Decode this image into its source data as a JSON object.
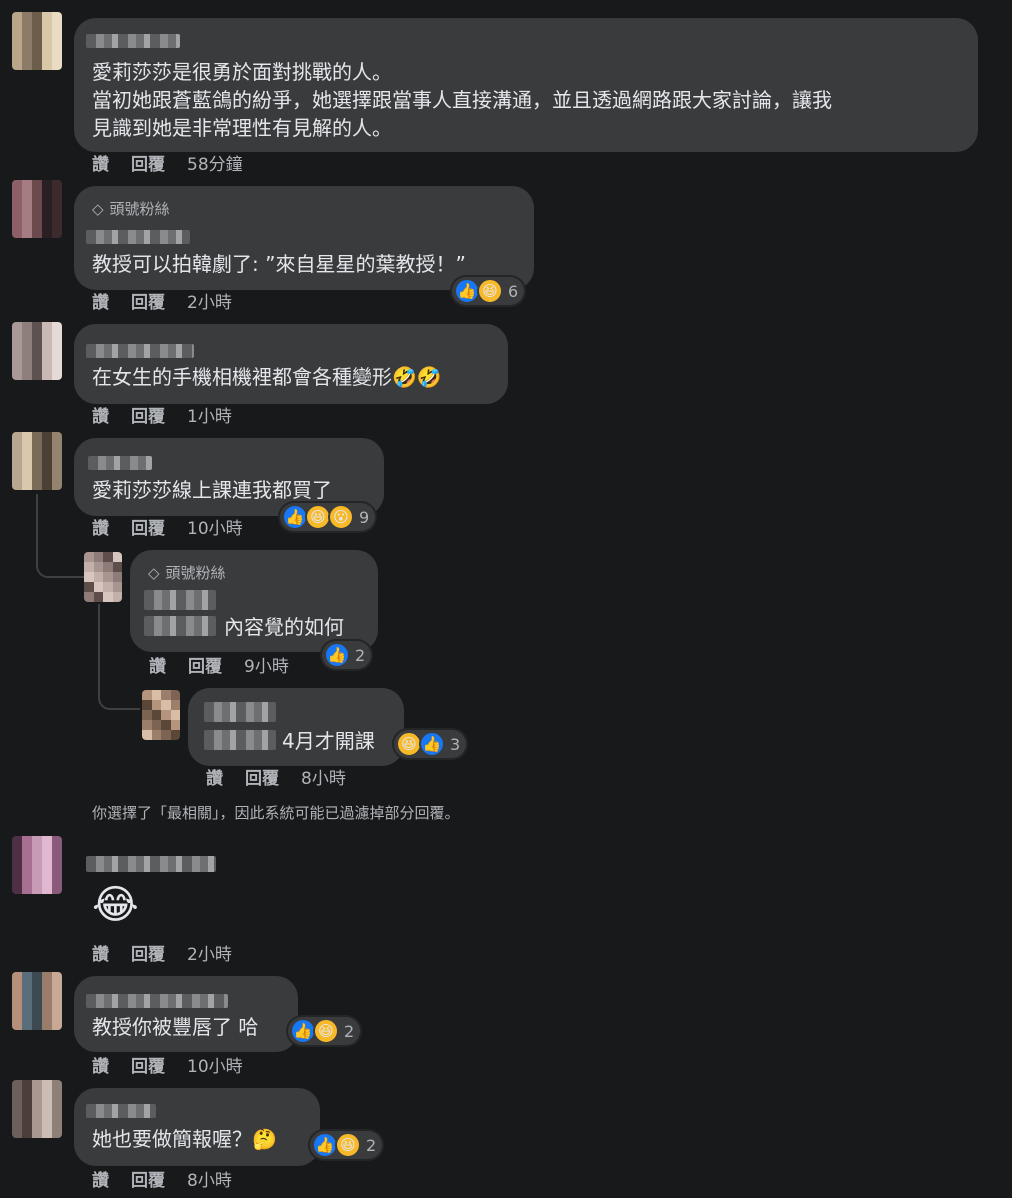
{
  "actions": {
    "like": "讚",
    "reply": "回覆"
  },
  "fan_badge": "頭號粉絲",
  "comments": [
    {
      "lines": [
        "愛莉莎莎是很勇於面對挑戰的人。",
        "當初她跟蒼藍鴿的紛爭，她選擇跟當事人直接溝通，並且透過網路跟大家討論，讓我",
        "見識到她是非常理性有見解的人。"
      ],
      "time": "58分鐘"
    },
    {
      "badge": "頭號粉絲",
      "text": "教授可以拍韓劇了: ”來自星星的葉教授！”",
      "time": "2小時",
      "reactions": [
        "like-icon",
        "haha-icon"
      ],
      "reaction_count": "6"
    },
    {
      "text": "在女生的手機相機裡都會各種變形🤣🤣",
      "time": "1小時"
    },
    {
      "text": "愛莉莎莎線上課連我都買了",
      "time": "10小時",
      "reactions": [
        "like-icon",
        "haha-icon",
        "wow-icon"
      ],
      "reaction_count": "9"
    },
    {
      "badge": "頭號粉絲",
      "text": "內容覺的如何",
      "time": "9小時",
      "reactions": [
        "like-icon"
      ],
      "reaction_count": "2"
    },
    {
      "text": "4月才開課",
      "time": "8小時",
      "reactions": [
        "haha-icon",
        "like-icon"
      ],
      "reaction_count": "3"
    },
    {
      "emoji": "😂",
      "time": "2小時"
    },
    {
      "text": "教授你被豐唇了 哈",
      "time": "10小時",
      "reactions": [
        "like-icon",
        "haha-icon"
      ],
      "reaction_count": "2"
    },
    {
      "text": "她也要做簡報喔？🤔",
      "time": "8小時",
      "reactions": [
        "like-icon",
        "haha-icon"
      ],
      "reaction_count": "2"
    }
  ],
  "filter_note": "你選擇了「最相關」，因此系統可能已過濾掉部分回覆。",
  "colors": {
    "background": "#18191a",
    "bubble": "#3a3b3c",
    "text": "#e4e6eb",
    "secondary": "#b0b3b8",
    "like": "#1877f2",
    "haha": "#f7b928"
  }
}
